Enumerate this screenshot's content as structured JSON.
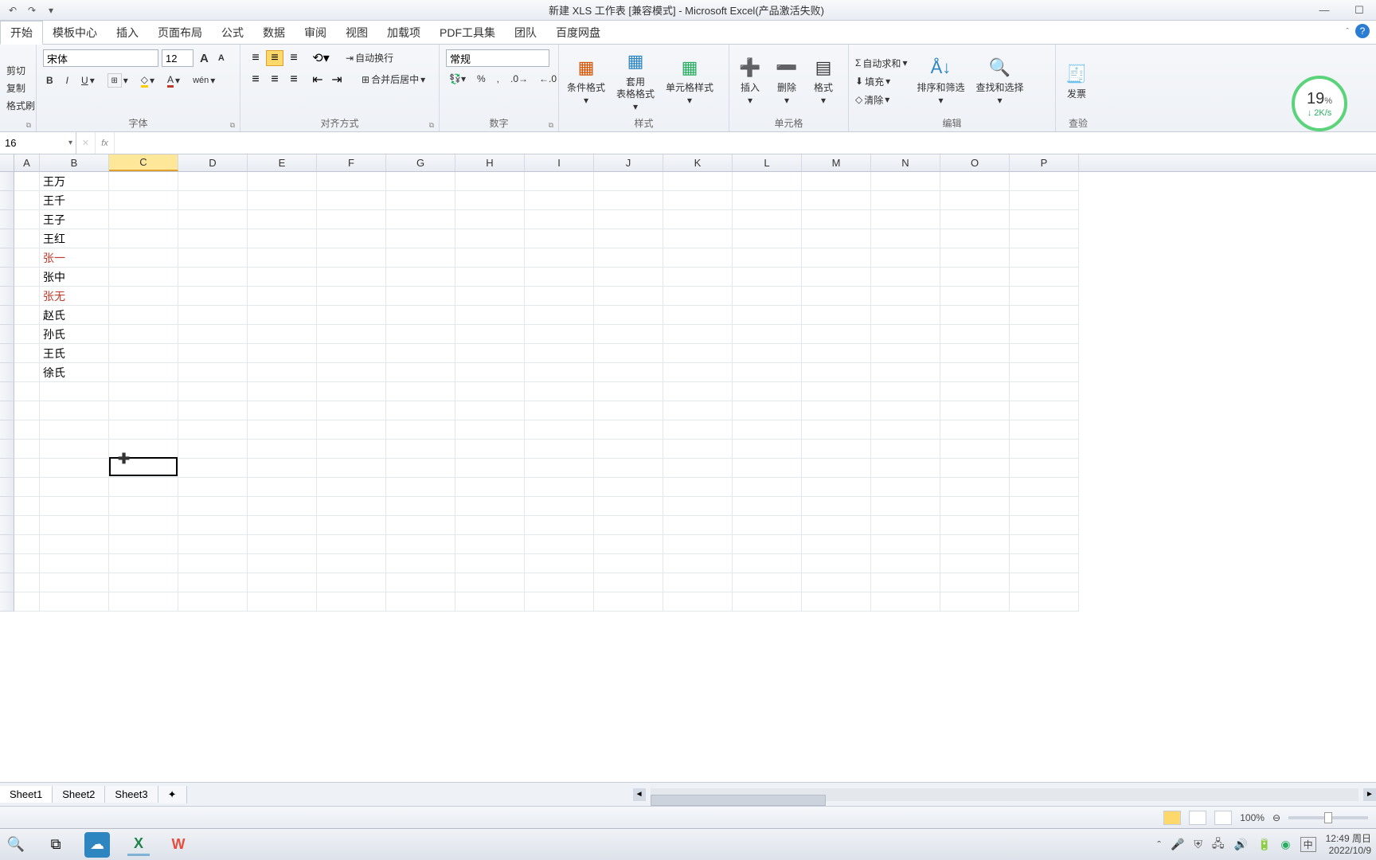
{
  "title": "新建 XLS 工作表  [兼容模式] - Microsoft Excel(产品激活失败)",
  "tabs": [
    "开始",
    "模板中心",
    "插入",
    "页面布局",
    "公式",
    "数据",
    "审阅",
    "视图",
    "加载项",
    "PDF工具集",
    "团队",
    "百度网盘"
  ],
  "clipboard": {
    "cut": "剪切",
    "copy": "复制",
    "brush": "格式刷"
  },
  "font": {
    "name": "宋体",
    "size": "12",
    "group": "字体"
  },
  "align": {
    "group": "对齐方式",
    "wrap": "自动换行",
    "merge": "合并后居中"
  },
  "number": {
    "format": "常规",
    "group": "数字"
  },
  "styles": {
    "cond": "条件格式",
    "table": "套用\n表格格式",
    "cell": "单元格样式",
    "group": "样式"
  },
  "cells": {
    "insert": "插入",
    "delete": "删除",
    "format": "格式",
    "group": "单元格"
  },
  "editing": {
    "sum": "自动求和",
    "fill": "填充",
    "clear": "清除",
    "sort": "排序和筛选",
    "find": "查找和选择",
    "group": "编辑"
  },
  "invoice": {
    "label1": "发票",
    "label2": "查验"
  },
  "namebox": "16",
  "speed": {
    "pct": "19",
    "unit": "%",
    "rate": "2K/s"
  },
  "columns": [
    "A",
    "B",
    "C",
    "D",
    "E",
    "F",
    "G",
    "H",
    "I",
    "J",
    "K",
    "L",
    "M",
    "N",
    "O",
    "P"
  ],
  "data_b": [
    {
      "v": "王万",
      "red": false
    },
    {
      "v": "王千",
      "red": false
    },
    {
      "v": "王子",
      "red": false
    },
    {
      "v": "王红",
      "red": false
    },
    {
      "v": "张一",
      "red": true
    },
    {
      "v": "张中",
      "red": false
    },
    {
      "v": "张无",
      "red": true
    },
    {
      "v": "赵氏",
      "red": false
    },
    {
      "v": "孙氏",
      "red": false
    },
    {
      "v": "王氏",
      "red": false
    },
    {
      "v": "徐氏",
      "red": false
    }
  ],
  "sheets": [
    "Sheet1",
    "Sheet2",
    "Sheet3"
  ],
  "zoom": "100%",
  "ime": "中",
  "clock": {
    "time": "12:49",
    "day": "周日",
    "date": "2022/10/9"
  }
}
